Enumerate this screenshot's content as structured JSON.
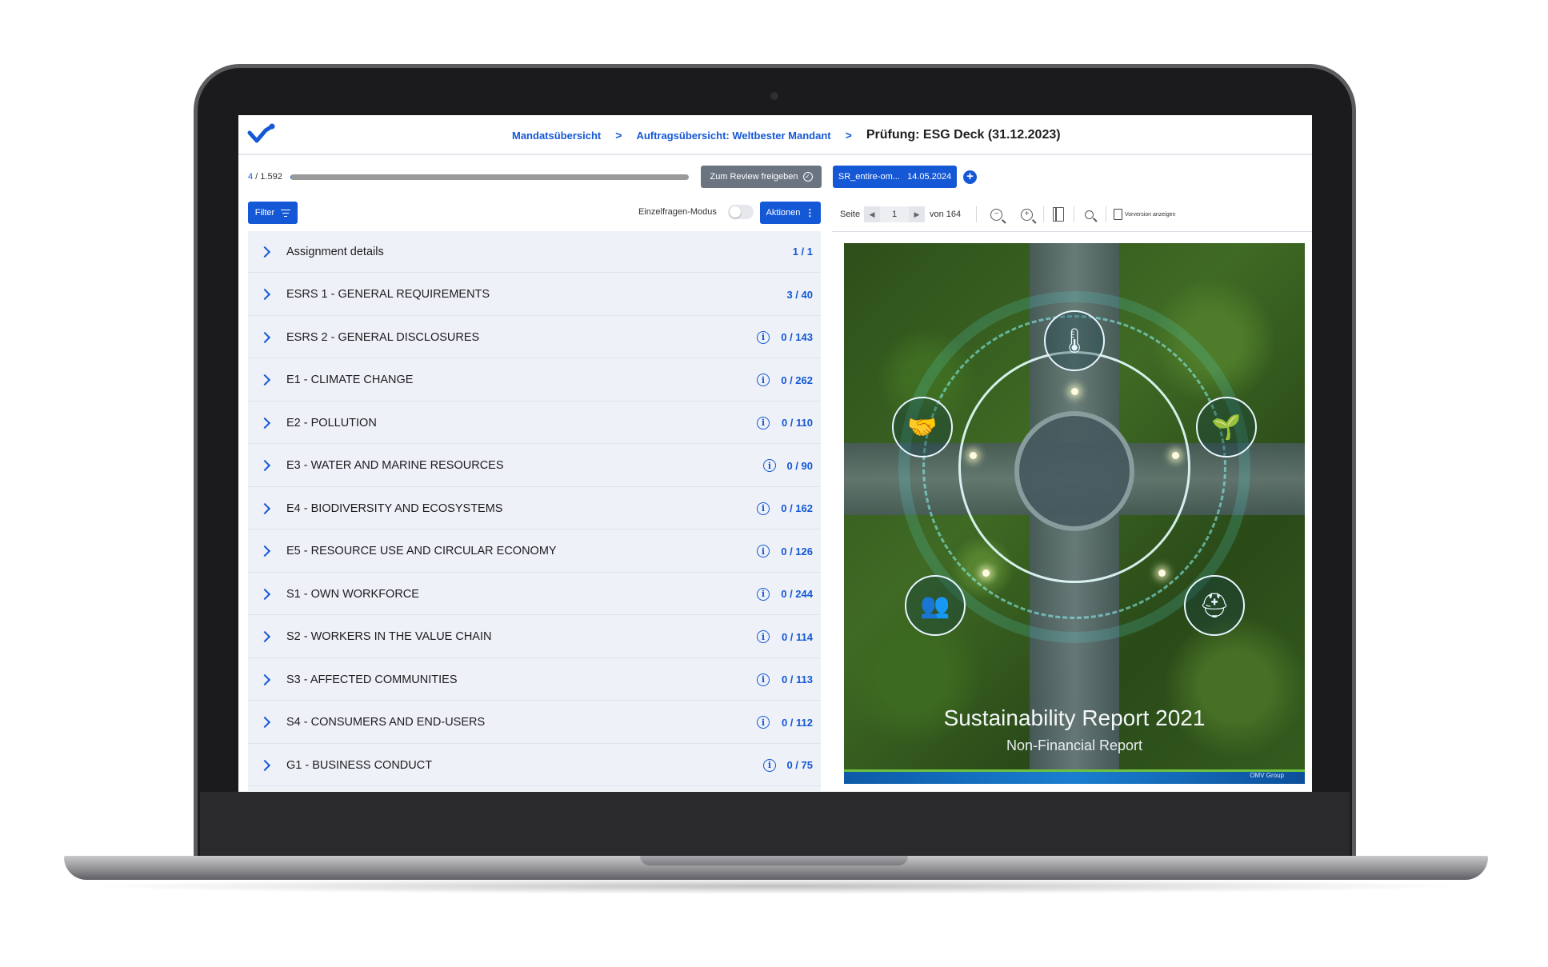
{
  "breadcrumb": {
    "mandates": "Mandatsübersicht",
    "orders": "Auftragsübersicht: Weltbester Mandant",
    "current": "Prüfung: ESG Deck (31.12.2023)",
    "separator": ">"
  },
  "progress": {
    "current": "4",
    "total_label": " / 1.592",
    "fraction": 0.0025
  },
  "toolbar": {
    "review_label": "Zum Review freigeben",
    "document_label": "SR_entire-om...   14.05.2024",
    "add_label": "+",
    "filter_label": "Filter",
    "mode_label": "Einzelfragen-Modus",
    "mode_on": false,
    "actions_label": "Aktionen"
  },
  "sections": [
    {
      "label": "Assignment details",
      "count": "1 / 1",
      "info": false
    },
    {
      "label": "ESRS 1 - GENERAL REQUIREMENTS",
      "count": "3 / 40",
      "info": false
    },
    {
      "label": "ESRS 2 - GENERAL DISCLOSURES",
      "count": "0 / 143",
      "info": true
    },
    {
      "label": "E1 - CLIMATE CHANGE",
      "count": "0 / 262",
      "info": true
    },
    {
      "label": "E2 - POLLUTION",
      "count": "0 / 110",
      "info": true
    },
    {
      "label": "E3 - WATER AND MARINE RESOURCES",
      "count": "0 / 90",
      "info": true
    },
    {
      "label": "E4 - BIODIVERSITY AND ECOSYSTEMS",
      "count": "0 / 162",
      "info": true
    },
    {
      "label": "E5 - RESOURCE USE AND CIRCULAR ECONOMY",
      "count": "0 / 126",
      "info": true
    },
    {
      "label": "S1 - OWN WORKFORCE",
      "count": "0 / 244",
      "info": true
    },
    {
      "label": "S2 - WORKERS IN THE VALUE CHAIN",
      "count": "0 / 114",
      "info": true
    },
    {
      "label": "S3 - AFFECTED COMMUNITIES",
      "count": "0 / 113",
      "info": true
    },
    {
      "label": "S4 - CONSUMERS AND END-USERS",
      "count": "0 / 112",
      "info": true
    },
    {
      "label": "G1 - BUSINESS CONDUCT",
      "count": "0 / 75",
      "info": true
    }
  ],
  "viewer": {
    "page_label": "Seite",
    "page_value": "1",
    "of_label": "von 164",
    "prev_version_label": "Vorversion anzeigen"
  },
  "cover": {
    "title": "Sustainability Report 2021",
    "subtitle": "Non-Financial Report",
    "brand": "OMV Group"
  },
  "colors": {
    "accent": "#1558d6",
    "review_button": "#6b7582",
    "list_background": "#eef1f7"
  },
  "icons": [
    "logo-icon",
    "chevron-right-icon",
    "info-icon",
    "filter-icon",
    "check-circle-icon",
    "more-vertical-icon",
    "zoom-out-icon",
    "zoom-in-icon",
    "fit-page-icon",
    "search-icon",
    "document-icon"
  ]
}
